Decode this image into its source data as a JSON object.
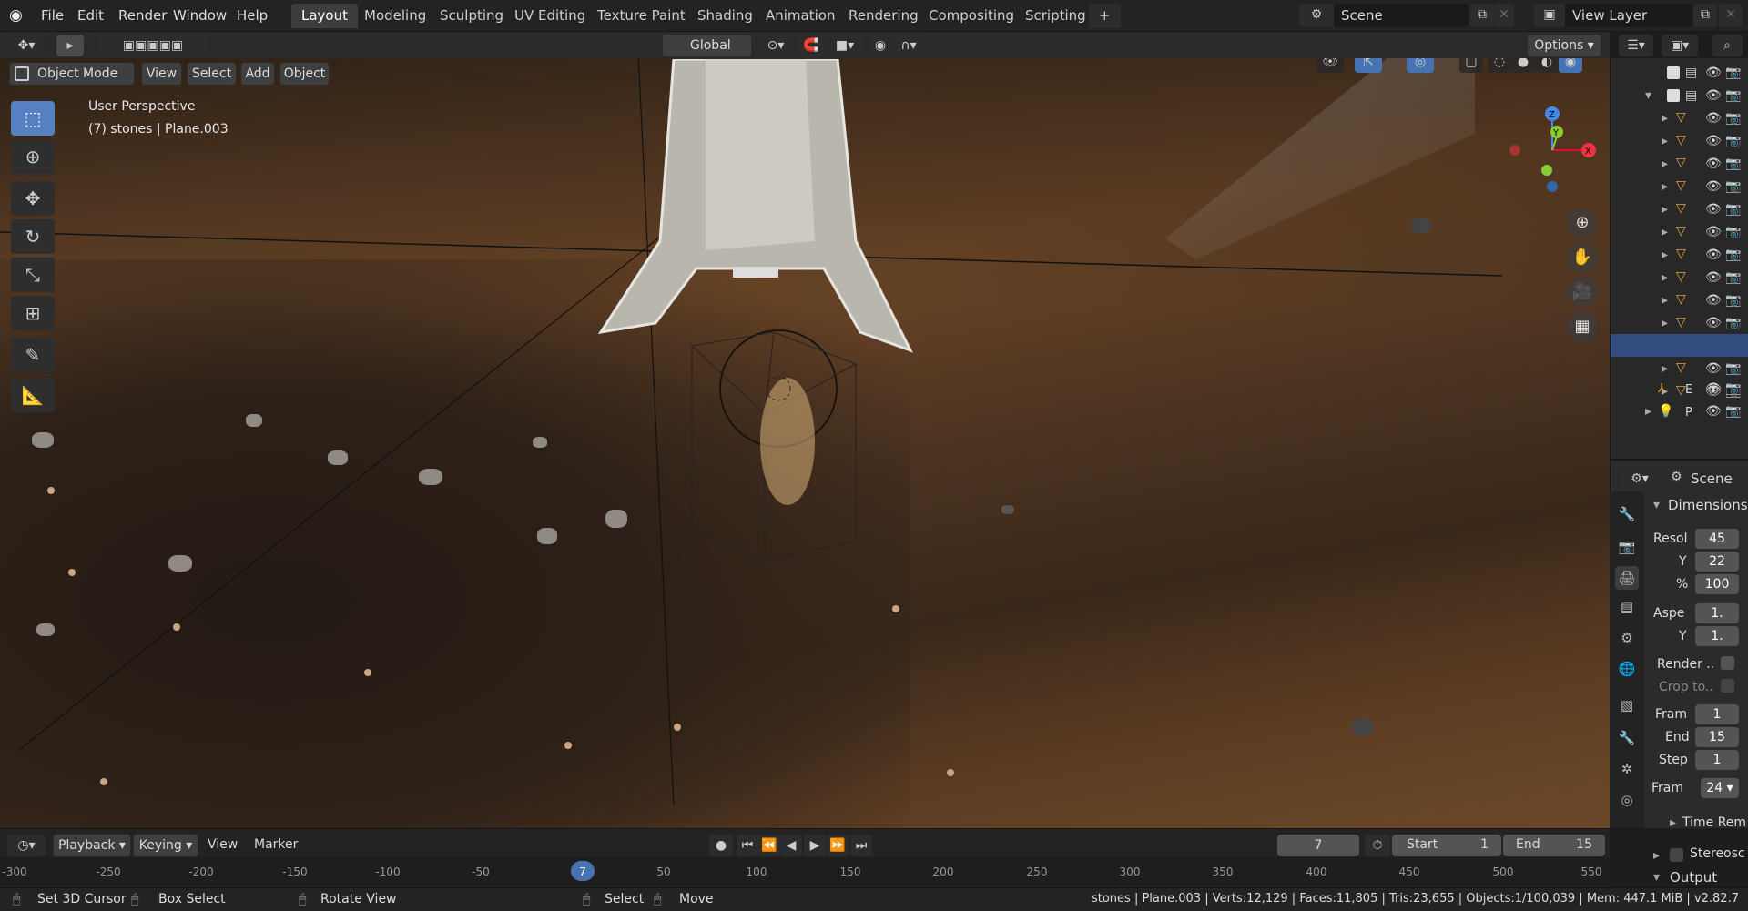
{
  "menu": {
    "items": [
      "File",
      "Edit",
      "Render",
      "Window",
      "Help"
    ]
  },
  "workspaces": {
    "tabs": [
      "Layout",
      "Modeling",
      "Sculpting",
      "UV Editing",
      "Texture Paint",
      "Shading",
      "Animation",
      "Rendering",
      "Compositing",
      "Scripting"
    ],
    "add_label": "+",
    "active": "Layout"
  },
  "scene": {
    "label": "Scene"
  },
  "view_layer": {
    "label": "View Layer"
  },
  "header": {
    "transform_orientation": "Global",
    "options_label": "Options"
  },
  "viewport_header": {
    "mode": "Object Mode",
    "menus": [
      "View",
      "Select",
      "Add",
      "Object"
    ]
  },
  "viewport_overlay": {
    "perspective": "User Perspective",
    "object_info": "(7) stones | Plane.003"
  },
  "gizmo": {
    "x": "X",
    "y": "Y",
    "z": "Z"
  },
  "outliner": {
    "rows": [
      "",
      "",
      "",
      "",
      "",
      "",
      "",
      "",
      "",
      "",
      "",
      "",
      "",
      "",
      "",
      "E",
      "P"
    ]
  },
  "properties": {
    "scene_label": "Scene",
    "panel_dimensions": "Dimensions",
    "resolution_x_label": "Resol",
    "resolution_x": "45",
    "resolution_y_label": "Y",
    "resolution_y": "22",
    "resolution_pct_label": "%",
    "resolution_pct": "100",
    "aspect_x_label": "Aspe",
    "aspect_x": "1.",
    "aspect_y_label": "Y",
    "aspect_y": "1.",
    "render_region": "Render ..",
    "crop": "Crop to..",
    "frame_start_label": "Fram",
    "frame_start": "1",
    "frame_end_label": "End",
    "frame_end": "15",
    "frame_step_label": "Step",
    "frame_step": "1",
    "frame_rate_label": "Fram",
    "frame_rate": "24",
    "time_remap": "Time Rem",
    "stereoscopy": "Stereosc",
    "output": "Output"
  },
  "timeline": {
    "playback": "Playback",
    "keying": "Keying",
    "view": "View",
    "marker": "Marker",
    "current_frame": "7",
    "start_label": "Start",
    "start": "1",
    "end_label": "End",
    "end": "15",
    "ruler_ticks": [
      "-300",
      "-250",
      "-200",
      "-150",
      "-100",
      "-50",
      "7",
      "50",
      "100",
      "150",
      "200",
      "250",
      "300",
      "350",
      "400",
      "450",
      "500",
      "550"
    ]
  },
  "statusbar": {
    "set_cursor": "Set 3D Cursor",
    "box_select": "Box Select",
    "rotate_view": "Rotate View",
    "select": "Select",
    "move": "Move",
    "stats": "stones | Plane.003 | Verts:12,129 | Faces:11,805 | Tris:23,655 | Objects:1/100,039 | Mem: 447.1 MiB | v2.82.7"
  }
}
